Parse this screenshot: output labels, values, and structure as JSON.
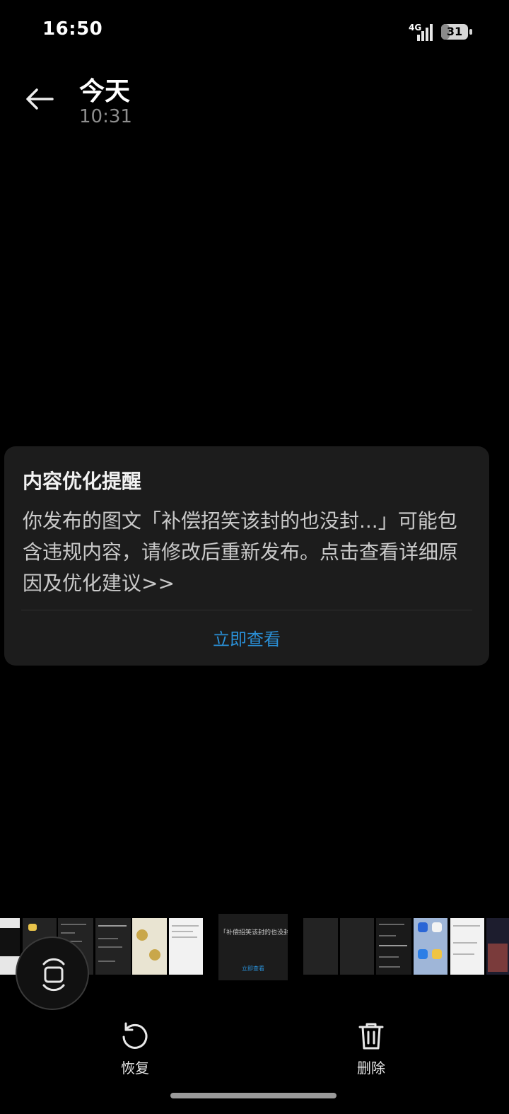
{
  "status_bar": {
    "time": "16:50",
    "network": "4G",
    "battery": "31"
  },
  "header": {
    "title": "今天",
    "subtitle": "10:31"
  },
  "card": {
    "title": "内容优化提醒",
    "body": "你发布的图文「补偿招笑该封的也没封...」可能包含违规内容，请修改后重新发布。点击查看详细原因及优化建议>>",
    "action": "立即查看"
  },
  "filmstrip": {
    "current": {
      "text": "「补偿招笑该封的也没封…修改后重新发布。点击查",
      "action": "立即查看"
    }
  },
  "bottom_bar": {
    "restore_label": "恢复",
    "delete_label": "删除"
  },
  "colors": {
    "background": "#000000",
    "card": "#1c1c1c",
    "accent": "#2a8fd6"
  },
  "icons": [
    "back-arrow-icon",
    "signal-icon",
    "battery-icon",
    "rotate-icon",
    "restore-icon",
    "delete-icon"
  ]
}
